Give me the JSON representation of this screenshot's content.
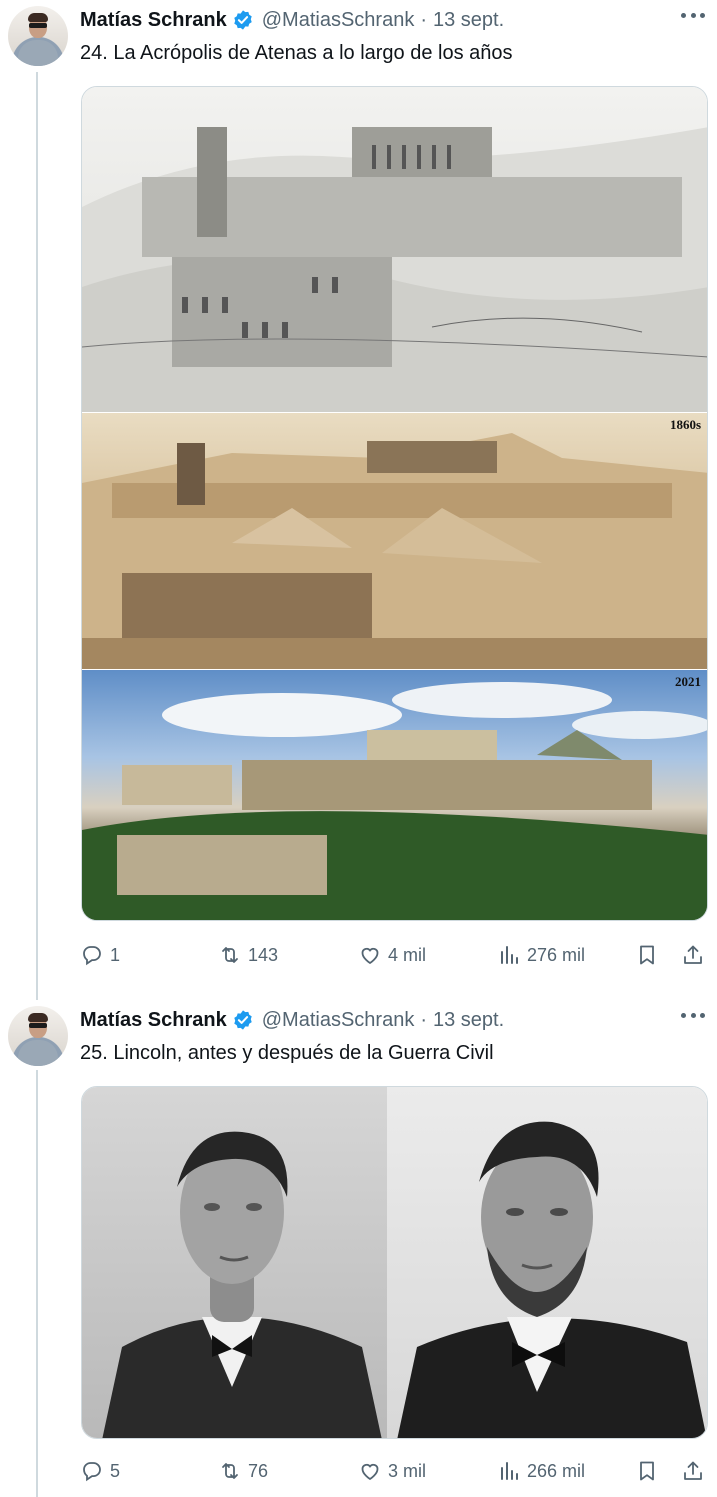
{
  "tweets": [
    {
      "name": "Matías Schrank",
      "handle": "@MatiasSchrank",
      "separator": "·",
      "date": "13 sept.",
      "text": "24. La Acrópolis de Atenas a lo largo de los años",
      "media_labels": [
        "1860s",
        "2021"
      ],
      "stats": {
        "replies": "1",
        "retweets": "143",
        "likes": "4 mil",
        "views": "276 mil"
      }
    },
    {
      "name": "Matías Schrank",
      "handle": "@MatiasSchrank",
      "separator": "·",
      "date": "13 sept.",
      "text": "25. Lincoln, antes y después de la Guerra Civil",
      "stats": {
        "replies": "5",
        "retweets": "76",
        "likes": "3 mil",
        "views": "266 mil"
      }
    }
  ],
  "icons": [
    "avatar",
    "verified-badge-icon",
    "more-icon",
    "reply-icon",
    "retweet-icon",
    "like-icon",
    "views-icon",
    "bookmark-icon",
    "share-icon"
  ],
  "colors": {
    "text": "#0f1419",
    "secondary": "#536471",
    "verified": "#1d9bf0",
    "line": "#cfd9de"
  }
}
